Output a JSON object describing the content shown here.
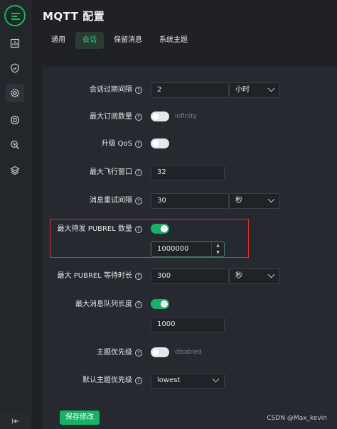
{
  "header": {
    "title": "MQTT 配置"
  },
  "tabs": [
    {
      "label": "通用",
      "active": false
    },
    {
      "label": "会话",
      "active": true
    },
    {
      "label": "保留消息",
      "active": false
    },
    {
      "label": "系统主题",
      "active": false
    }
  ],
  "rail": {
    "icons": [
      "dashboard-icon",
      "shield-icon",
      "gear-icon",
      "plugin-icon",
      "diagnose-icon",
      "layers-icon"
    ],
    "active_icon": "gear-icon",
    "collapse_icon": "collapse-icon"
  },
  "form": {
    "session_expiry": {
      "label": "会话过期间隔",
      "value": "2",
      "unit": "小时"
    },
    "max_subscriptions": {
      "label": "最大订阅数量",
      "toggle_on": false,
      "hint": "infinity"
    },
    "upgrade_qos": {
      "label": "升级 QoS",
      "toggle_on": false
    },
    "max_inflight": {
      "label": "最大飞行窗口",
      "value": "32"
    },
    "retry_interval": {
      "label": "消息重试间隔",
      "value": "30",
      "unit": "秒"
    },
    "max_awaiting_rel": {
      "label": "最大待发 PUBREL 数量",
      "toggle_on": true,
      "value": "1000000"
    },
    "await_rel_timeout": {
      "label": "最大 PUBREL 等待时长",
      "value": "300",
      "unit": "秒"
    },
    "max_mqueue_len": {
      "label": "最大消息队列长度",
      "toggle_on": true,
      "value": "1000"
    },
    "topic_priority": {
      "label": "主题优先级",
      "toggle_on": false,
      "hint": "disabled"
    },
    "default_priority": {
      "label": "默认主题优先级",
      "value": "lowest"
    }
  },
  "actions": {
    "save_label": "保存修改"
  },
  "watermark": "CSDN @Max_kevin",
  "colors": {
    "accent": "#17b26a",
    "highlight_border": "#e0302e",
    "background": "#1f2126",
    "panel": "#262930"
  }
}
